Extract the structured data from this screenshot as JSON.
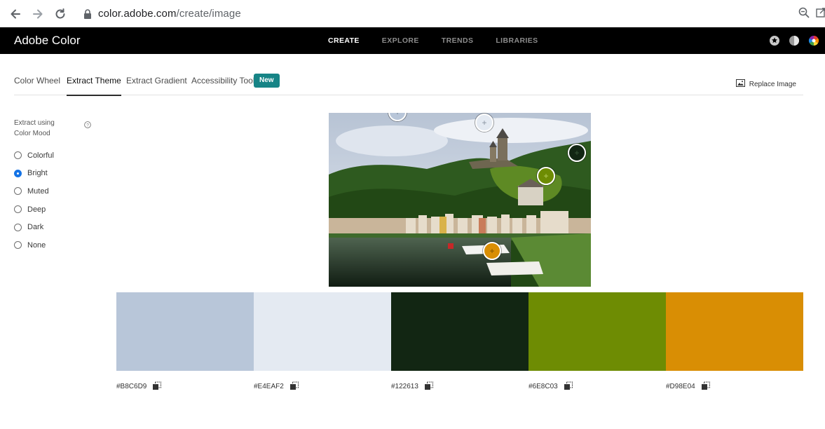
{
  "browser": {
    "url_host": "color.adobe.com",
    "url_path": "/create/image"
  },
  "header": {
    "brand": "Adobe Color",
    "nav": [
      {
        "label": "CREATE",
        "active": true
      },
      {
        "label": "EXPLORE",
        "active": false
      },
      {
        "label": "TRENDS",
        "active": false
      },
      {
        "label": "LIBRARIES",
        "active": false
      }
    ]
  },
  "tabs": {
    "items": [
      {
        "label": "Color Wheel",
        "active": false
      },
      {
        "label": "Extract Theme",
        "active": true
      },
      {
        "label": "Extract Gradient",
        "active": false
      },
      {
        "label": "Accessibility Tools",
        "active": false
      }
    ],
    "new_badge": "New",
    "replace_label": "Replace Image"
  },
  "mood": {
    "heading": "Extract using Color Mood",
    "options": [
      {
        "label": "Colorful",
        "checked": false
      },
      {
        "label": "Bright",
        "checked": true
      },
      {
        "label": "Muted",
        "checked": false
      },
      {
        "label": "Deep",
        "checked": false
      },
      {
        "label": "Dark",
        "checked": false
      },
      {
        "label": "None",
        "checked": false
      }
    ]
  },
  "theme": {
    "swatches": [
      {
        "hex": "#B8C6D9"
      },
      {
        "hex": "#E4EAF2"
      },
      {
        "hex": "#122613"
      },
      {
        "hex": "#6E8C03"
      },
      {
        "hex": "#D98E04"
      }
    ]
  },
  "colors": {
    "accent": "#1473E6",
    "badge": "#168486",
    "header_bg": "#000000"
  }
}
